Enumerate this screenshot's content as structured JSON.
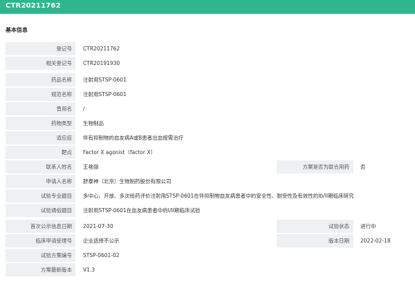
{
  "header": {
    "title": "CTR20211762"
  },
  "section": {
    "title": "基本信息"
  },
  "registration": [
    {
      "label": "登记号",
      "value": "CTR20211762"
    },
    {
      "label": "相关登记号",
      "value": "CTR20191930"
    }
  ],
  "drug": [
    {
      "label": "药品名称",
      "value": "注射用STSP-0601"
    },
    {
      "label": "规范名称",
      "value": "注射用STSP-0601"
    },
    {
      "label": "曾用名",
      "value": "/"
    },
    {
      "label": "药物类型",
      "value": "生物制品"
    },
    {
      "label": "适应症",
      "value": "伴有抑制物的血友病A或B患者出血按需治疗"
    },
    {
      "label": "靶点",
      "value": "Factor X agonist（factor X）"
    }
  ],
  "contact": {
    "contact_name_label": "联系人姓名",
    "contact_name": "王艳丽",
    "joint_label": "方案是否为联合用药",
    "joint_value": "否",
    "applicant_label": "申请人名称",
    "applicant": "舒泰神（北京）生物制药股份有限公司",
    "professional_title_label": "试验专业题目",
    "professional_title": "多中心、开放、多次给药评价注射用STSP-0601在伴抑制物血友病患者中的安全性、耐受性及有效性的Ib/II期临床研究",
    "popular_title_label": "试验通俗题目",
    "popular_title": "注射用STSP-0601在血友病患者中的I/II期临床试验"
  },
  "status": {
    "first_pub_label": "首次公示信息日期",
    "first_pub": "2021-07-30",
    "trial_status_label": "试验状态",
    "trial_status": "进行中",
    "acceptance_label": "临床申请受理号",
    "acceptance": "企业选择不公示",
    "version_date_label": "版本日期",
    "version_date": "2022-02-18",
    "protocol_no_label": "试验方案编号",
    "protocol_no": "STSP-0601-02",
    "protocol_version_label": "方案最新版本",
    "protocol_version": "V1.3"
  }
}
